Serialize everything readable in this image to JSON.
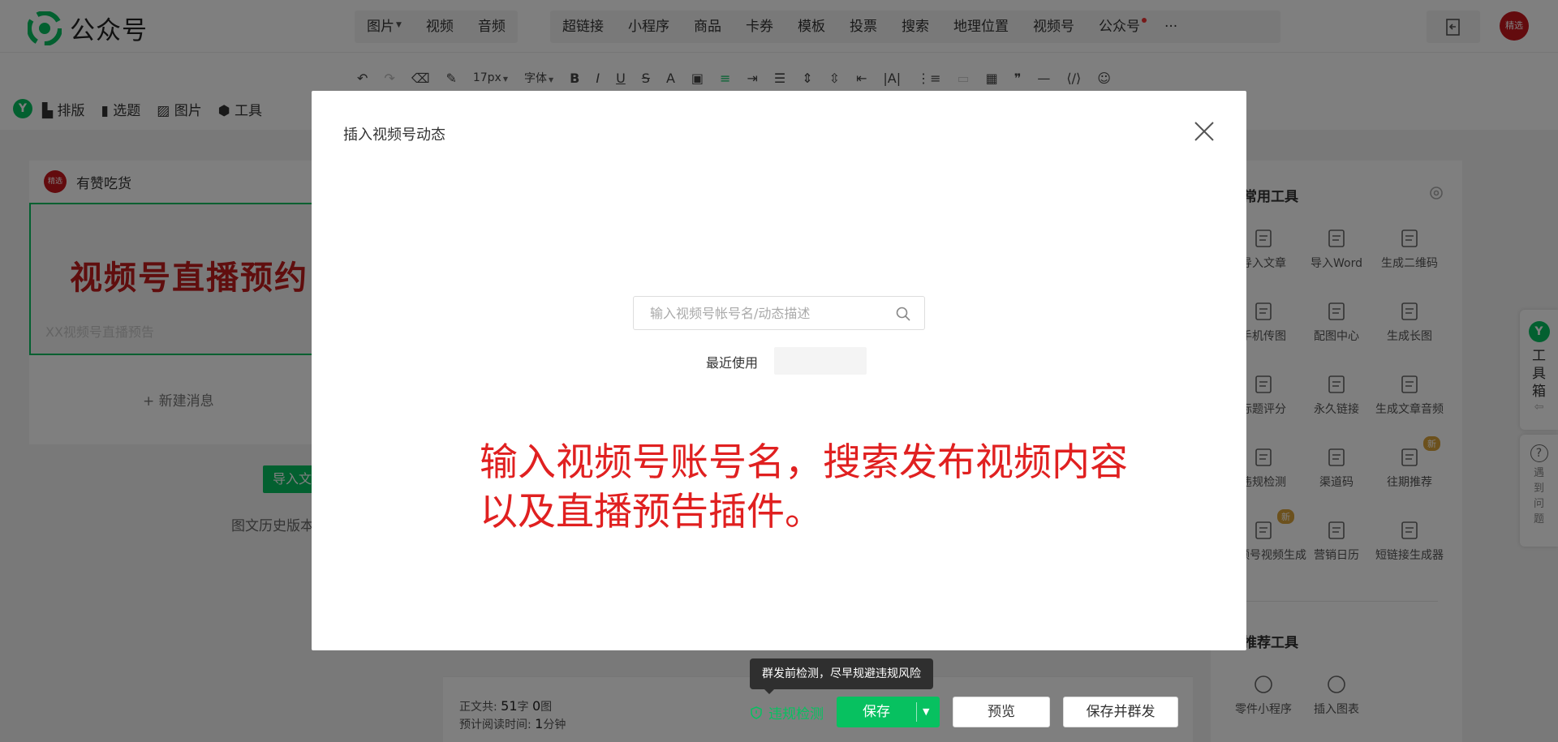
{
  "app": {
    "title": "公众号"
  },
  "nav": {
    "group1": [
      {
        "label": "图片",
        "has_caret": true
      },
      {
        "label": "视频"
      },
      {
        "label": "音频"
      }
    ],
    "group2": [
      {
        "label": "超链接"
      },
      {
        "label": "小程序"
      },
      {
        "label": "商品"
      },
      {
        "label": "卡券"
      },
      {
        "label": "模板"
      },
      {
        "label": "投票"
      },
      {
        "label": "搜索"
      },
      {
        "label": "地理位置"
      },
      {
        "label": "视频号"
      },
      {
        "label": "公众号",
        "has_dot": true
      },
      {
        "label": "···"
      }
    ],
    "avatar_text": "精选"
  },
  "toolbar": {
    "font_size": "17px",
    "font_family": "字体",
    "left_tools": [
      "排版",
      "选题",
      "图片",
      "工具"
    ]
  },
  "left_panel": {
    "account_name": "有赞吃货",
    "avatar_text": "精选",
    "card_title": "视频号直播预约",
    "card_subtitle": "XX视频号直播预告",
    "new_message": "+ 新建消息",
    "import_button": "导入文章",
    "history_link": "图文历史版本"
  },
  "right_panel": {
    "section1_title": "常用工具",
    "section2_title": "推荐工具",
    "tools": [
      {
        "label": "导入文章",
        "icon": "import-article-icon"
      },
      {
        "label": "导入Word",
        "icon": "word-icon"
      },
      {
        "label": "生成二维码",
        "icon": "qrcode-icon"
      },
      {
        "label": "手机传图",
        "icon": "phone-upload-icon"
      },
      {
        "label": "配图中心",
        "icon": "image-center-icon"
      },
      {
        "label": "生成长图",
        "icon": "long-image-icon"
      },
      {
        "label": "标题评分",
        "icon": "title-score-icon"
      },
      {
        "label": "永久链接",
        "icon": "link-icon"
      },
      {
        "label": "生成文章音频",
        "icon": "music-icon"
      },
      {
        "label": "违规检测",
        "icon": "shield-icon"
      },
      {
        "label": "渠道码",
        "icon": "channel-code-icon"
      },
      {
        "label": "往期推荐",
        "icon": "thumbs-up-icon",
        "badge": "新"
      },
      {
        "label": "视频号视频生成",
        "icon": "video-gen-icon",
        "badge": "新"
      },
      {
        "label": "营销日历",
        "icon": "calendar-icon"
      },
      {
        "label": "短链接生成器",
        "icon": "short-link-icon"
      }
    ],
    "recommended": [
      {
        "label": "零件小程序",
        "icon": "mini-program-icon"
      },
      {
        "label": "插入图表",
        "icon": "chart-icon"
      }
    ]
  },
  "side_toolbox": {
    "logo": "Y",
    "label": "工具箱",
    "help": "?",
    "help_label": "遇到问题"
  },
  "editor_bottom": {
    "stat_prefix": "正文共:",
    "char_count": "51",
    "char_unit": "字",
    "image_count": "0",
    "image_unit": "图",
    "read_prefix": "预计阅读时间:",
    "read_time": "1",
    "read_unit": "分钟",
    "tooltip": "群发前检测，尽早规避违规风险",
    "check_link": "违规检测",
    "save": "保存",
    "preview": "预览",
    "save_send": "保存并群发"
  },
  "modal": {
    "title": "插入视频号动态",
    "search_placeholder": "输入视频号帐号名/动态描述",
    "search_value": "",
    "recent_label": "最近使用",
    "annotation": "输入视频号账号名，搜索发布视频内容\n以及直播预告插件。"
  },
  "colors": {
    "brand_green": "#07c160",
    "annotation_red": "#e02020",
    "card_title_red": "#c01c1c"
  }
}
